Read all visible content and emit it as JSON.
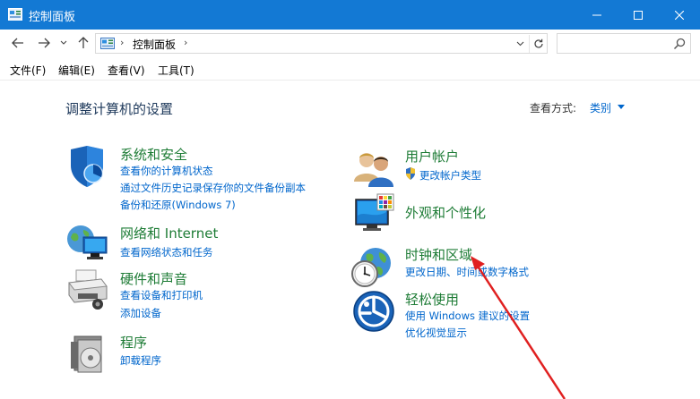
{
  "window": {
    "title": "控制面板"
  },
  "nav": {
    "breadcrumb_root_sep": "›",
    "breadcrumb": "控制面板",
    "breadcrumb_sep": "›",
    "search_placeholder": ""
  },
  "menu": {
    "file": "文件(F)",
    "edit": "编辑(E)",
    "view": "查看(V)",
    "tools": "工具(T)"
  },
  "main": {
    "heading": "调整计算机的设置",
    "view_by_label": "查看方式:",
    "view_by_value": "类别"
  },
  "categories_left": [
    {
      "title": "系统和安全",
      "links": [
        "查看你的计算机状态",
        "通过文件历史记录保存你的文件备份副本",
        "备份和还原(Windows 7)"
      ]
    },
    {
      "title": "网络和 Internet",
      "links": [
        "查看网络状态和任务"
      ]
    },
    {
      "title": "硬件和声音",
      "links": [
        "查看设备和打印机",
        "添加设备"
      ]
    },
    {
      "title": "程序",
      "links": [
        "卸载程序"
      ]
    }
  ],
  "categories_right": [
    {
      "title": "用户帐户",
      "links": [
        "更改帐户类型"
      ]
    },
    {
      "title": "外观和个性化",
      "links": []
    },
    {
      "title": "时钟和区域",
      "links": [
        "更改日期、时间或数字格式"
      ]
    },
    {
      "title": "轻松使用",
      "links": [
        "使用 Windows 建议的设置",
        "优化视觉显示"
      ]
    }
  ],
  "colors": {
    "titlebar": "#1379d4",
    "category_title": "#1e7c36",
    "link": "#0066cc",
    "annotation_arrow": "#e02020"
  }
}
